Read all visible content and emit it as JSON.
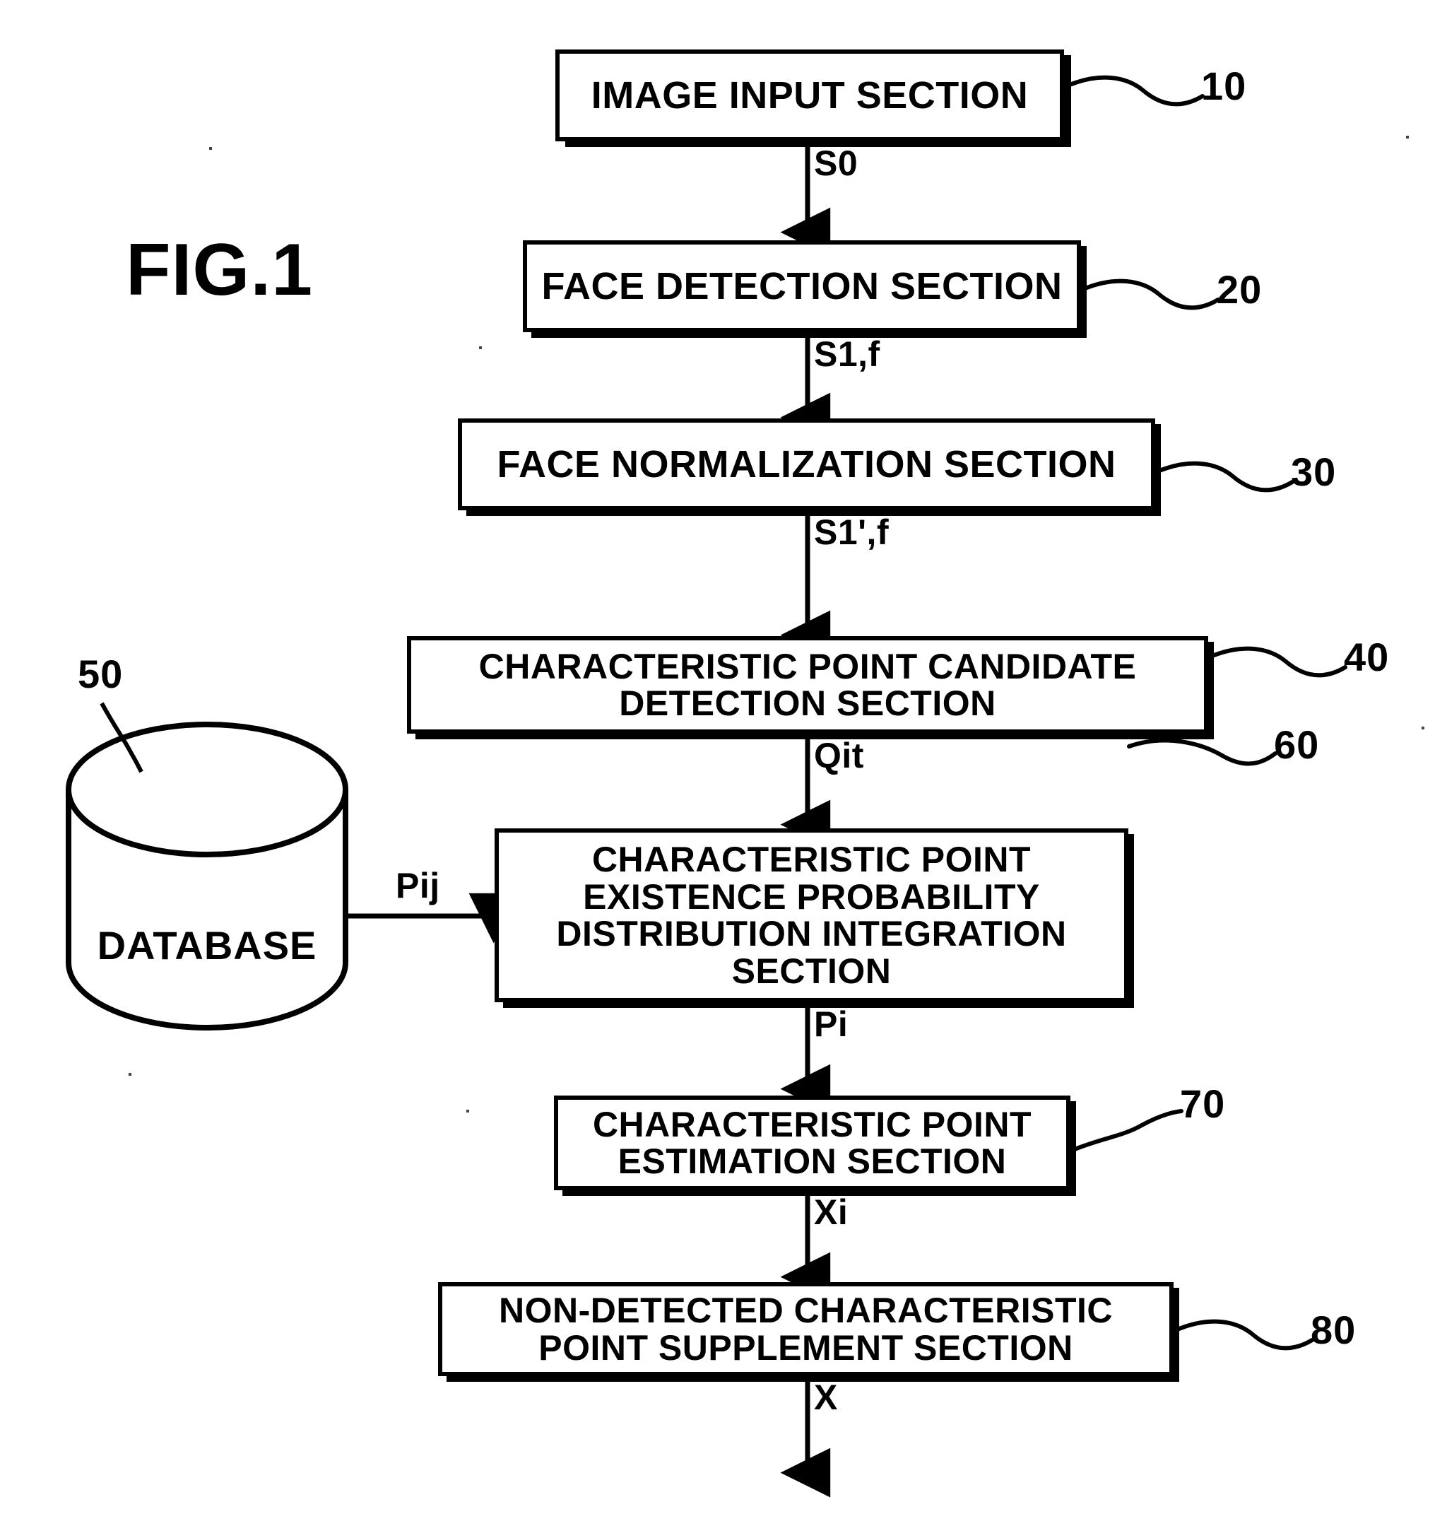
{
  "figure": {
    "title": "FIG.1",
    "kind": "block-diagram"
  },
  "nodes": [
    {
      "id": "10",
      "name": "image-input-section",
      "label": "IMAGE INPUT SECTION",
      "ref": "10"
    },
    {
      "id": "20",
      "name": "face-detection-section",
      "label": "FACE DETECTION SECTION",
      "ref": "20"
    },
    {
      "id": "30",
      "name": "face-normalization-section",
      "label": "FACE NORMALIZATION SECTION",
      "ref": "30"
    },
    {
      "id": "40",
      "name": "characteristic-point-candidate-detection-section",
      "label": "CHARACTERISTIC POINT CANDIDATE\nDETECTION SECTION",
      "ref": "40"
    },
    {
      "id": "50",
      "name": "database",
      "label": "DATABASE",
      "ref": "50"
    },
    {
      "id": "60",
      "name": "characteristic-point-existence-probability-distribution-integration-section",
      "label": "CHARACTERISTIC POINT\nEXISTENCE PROBABILITY\nDISTRIBUTION INTEGRATION\nSECTION",
      "ref": "60"
    },
    {
      "id": "70",
      "name": "characteristic-point-estimation-section",
      "label": "CHARACTERISTIC POINT\nESTIMATION SECTION",
      "ref": "70"
    },
    {
      "id": "80",
      "name": "non-detected-characteristic-point-supplement-section",
      "label": "NON-DETECTED CHARACTERISTIC\nPOINT SUPPLEMENT SECTION",
      "ref": "80"
    }
  ],
  "signals": [
    {
      "id": "s0",
      "label": "S0",
      "from": "10",
      "to": "20"
    },
    {
      "id": "s1f",
      "label": "S1,f",
      "from": "20",
      "to": "30"
    },
    {
      "id": "s1pf",
      "label": "S1',f",
      "from": "30",
      "to": "40"
    },
    {
      "id": "qit",
      "label": "Qit",
      "from": "40",
      "to": "60"
    },
    {
      "id": "pij",
      "label": "Pij",
      "from": "50",
      "to": "60"
    },
    {
      "id": "pi",
      "label": "Pi",
      "from": "60",
      "to": "70"
    },
    {
      "id": "xi",
      "label": "Xi",
      "from": "70",
      "to": "80"
    },
    {
      "id": "x",
      "label": "X",
      "from": "80",
      "to": "output"
    }
  ],
  "refnums": [
    "10",
    "20",
    "30",
    "40",
    "50",
    "60",
    "70",
    "80"
  ],
  "colors": {
    "stroke": "#000000",
    "fill": "#ffffff"
  }
}
